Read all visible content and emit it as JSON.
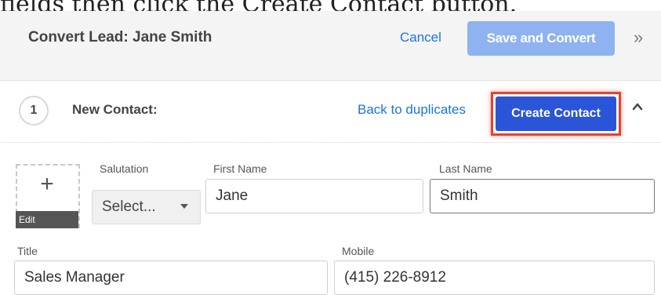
{
  "caption": "fields then click the Create Contact button.",
  "header": {
    "title": "Convert Lead: Jane Smith",
    "cancel_label": "Cancel",
    "save_label": "Save and Convert",
    "expand_icon": "double-chevron-right-icon"
  },
  "step": {
    "number": "1",
    "title": "New Contact:",
    "back_label": "Back to duplicates",
    "create_label": "Create Contact",
    "collapse_icon": "chevron-up-icon",
    "highlight_color": "#e8412c"
  },
  "avatar": {
    "add_icon": "+",
    "edit_label": "Edit"
  },
  "form": {
    "salutation": {
      "label": "Salutation",
      "value": "Select..."
    },
    "first_name": {
      "label": "First Name",
      "value": "Jane"
    },
    "last_name": {
      "label": "Last Name",
      "value": "Smith"
    },
    "title": {
      "label": "Title",
      "value": "Sales Manager"
    },
    "mobile": {
      "label": "Mobile",
      "value": "(415) 226-8912"
    }
  },
  "colors": {
    "link": "#1a73e8",
    "primary_button": "#2b55d9",
    "save_button": "#8fb3f0"
  }
}
